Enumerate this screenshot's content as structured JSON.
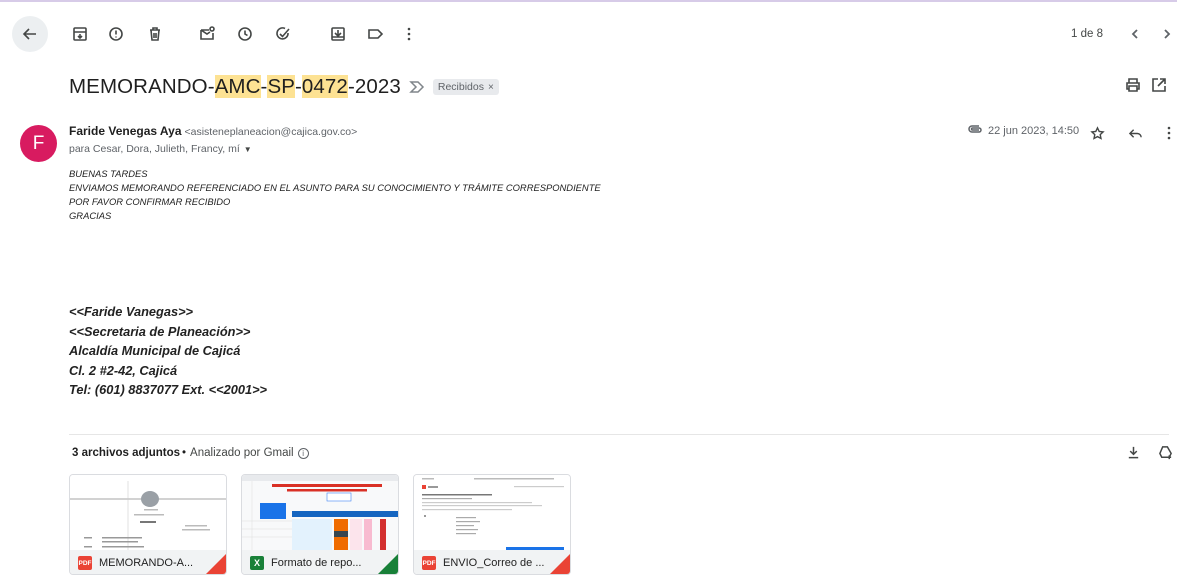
{
  "toolbar": {
    "pager": "1 de 8"
  },
  "subject": {
    "parts": [
      "MEMORANDO-",
      "AMC",
      "-",
      "SP",
      "-",
      "0472",
      "-2023"
    ],
    "label_chip": "Recibidos",
    "label_chip_close": "×"
  },
  "sender": {
    "avatar_letter": "F",
    "name": "Faride Venegas Aya",
    "email": "<asisteneplaneacion@cajica.gov.co>",
    "recipients": "para Cesar, Dora, Julieth, Francy, mí",
    "date": "22 jun 2023, 14:50"
  },
  "body": {
    "lines": [
      "BUENAS TARDES",
      "ENVIAMOS MEMORANDO REFERENCIADO EN EL ASUNTO PARA SU CONOCIMIENTO Y TRÁMITE CORRESPONDIENTE",
      "POR FAVOR CONFIRMAR RECIBIDO",
      "GRACIAS"
    ],
    "signature": [
      "<<Faride Vanegas>>",
      "<<Secretaria de Planeación>>",
      "Alcaldía Municipal de Cajicá",
      "Cl. 2 #2-42, Cajicá",
      "Tel: (601) 8837077  Ext. <<2001>>"
    ]
  },
  "attachments": {
    "count_label": "3 archivos adjuntos",
    "separator": "•",
    "scanned_label": "Analizado por Gmail",
    "info_glyph": "i",
    "files": [
      {
        "name": "MEMORANDO-A...",
        "type": "PDF"
      },
      {
        "name": "Formato de repo...",
        "type": "X"
      },
      {
        "name": "ENVIO_Correo de ...",
        "type": "PDF"
      }
    ]
  },
  "colors": {
    "avatar": "#d81b60",
    "highlight": "#fde293",
    "pdf": "#ea4335",
    "sheet": "#188038"
  }
}
